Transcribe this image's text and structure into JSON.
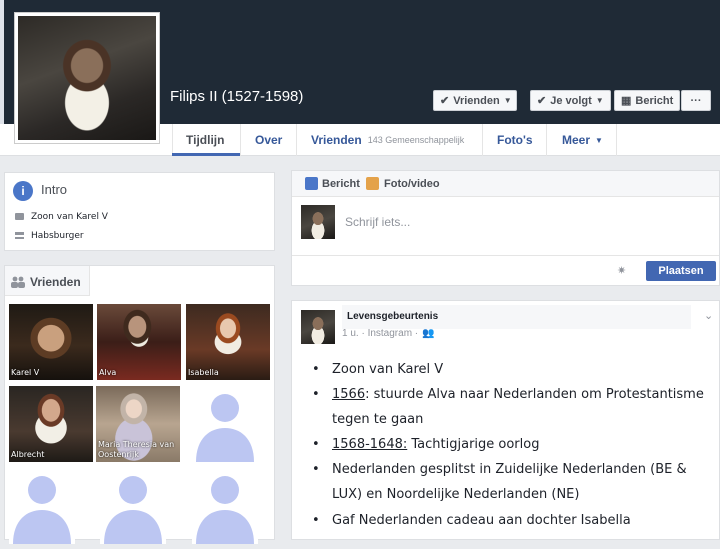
{
  "profile": {
    "name": "Filips II (1527-1598)"
  },
  "actions": {
    "friends_label": "Vrienden",
    "following_label": "Je volgt",
    "message_label": "Bericht",
    "more_label": "···"
  },
  "tabs": [
    {
      "label": "Tijdlijn"
    },
    {
      "label": "Over"
    },
    {
      "label": "Vrienden",
      "sub": "143 Gemeenschappelijk"
    },
    {
      "label": "Foto's"
    },
    {
      "label": "Meer"
    }
  ],
  "intro": {
    "title": "Intro",
    "items": [
      "Zoon van Karel V",
      "Habsburger"
    ]
  },
  "friends": {
    "title": "Vrienden",
    "items": [
      "Karel V",
      "Alva",
      "Isabella",
      "Albrecht",
      "Maria Theresia van Oostenrijk"
    ]
  },
  "composer": {
    "post_tab": "Bericht",
    "photo_tab": "Foto/video",
    "placeholder": "Schrijf iets...",
    "submit": "Plaatsen"
  },
  "post": {
    "title": "Levensgebeurtenis",
    "meta": "1 u. · Instagram ·",
    "bullets": [
      {
        "date": "",
        "text": "Zoon van Karel V"
      },
      {
        "date": "1566",
        "text": ": stuurde Alva naar Nederlanden om Protestantisme tegen te gaan"
      },
      {
        "date": "1568-1648:",
        "text": " Tachtigjarige oorlog"
      },
      {
        "date": "",
        "text": "Nederlanden gesplitst in Zuidelijke Nederlanden (BE & LUX) en Noordelijke Nederlanden (NE)"
      },
      {
        "date": "",
        "text": "Gaf Nederlanden cadeau aan dochter Isabella"
      }
    ]
  },
  "colors": {
    "cover": "#1f2a36",
    "link": "#365899",
    "primary_button": "#4267b2",
    "silhouette": "#bcc6f2"
  }
}
